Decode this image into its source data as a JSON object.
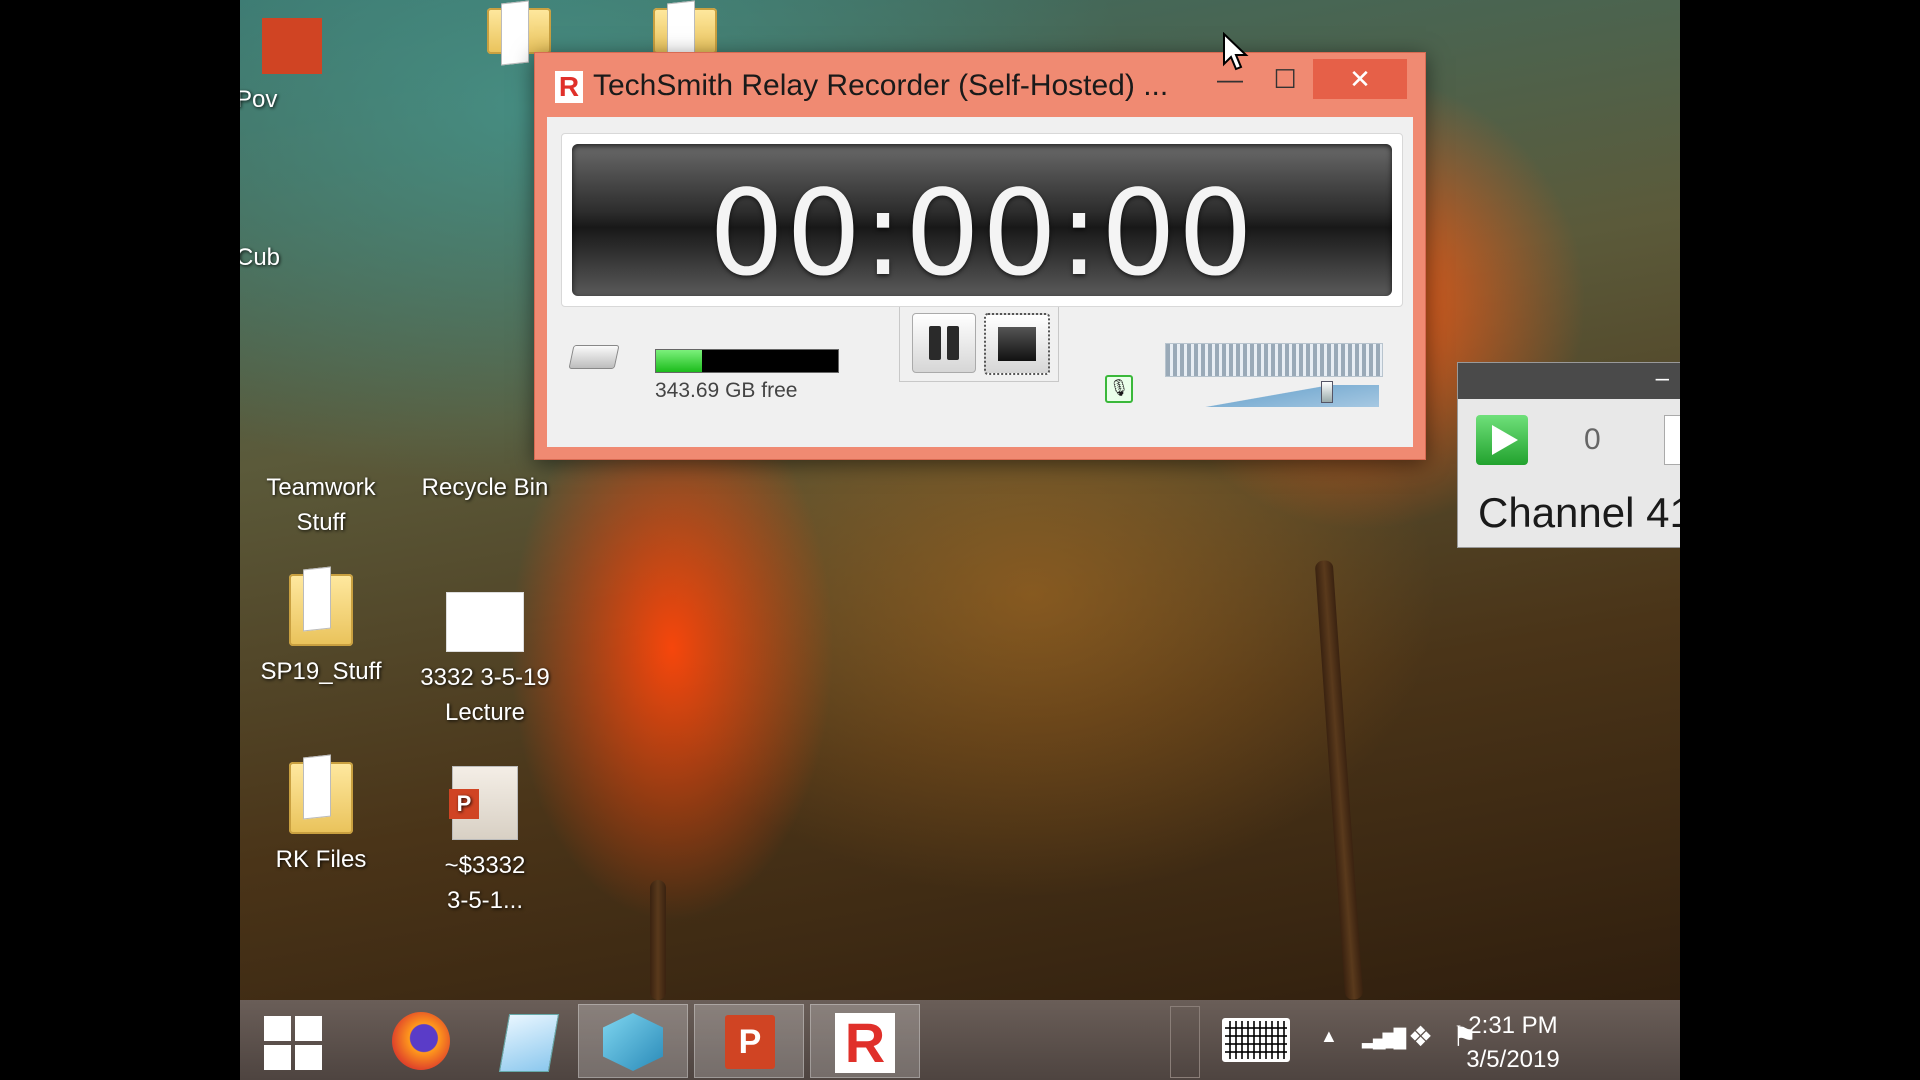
{
  "recorder": {
    "title": "TechSmith Relay Recorder (Self-Hosted) ...",
    "logo_letter": "R",
    "minimize_glyph": "—",
    "maximize_glyph": "☐",
    "close_glyph": "✕",
    "timer": "00:00:00",
    "disk_free": "343.69 GB free",
    "disk_usage_fraction": 0.25,
    "volume_level_fraction": 0.75,
    "accent_color": "#f08a72"
  },
  "desktop": {
    "icons": [
      {
        "label": "Pov",
        "icon": "powerpoint-icon"
      },
      {
        "label": "Cub",
        "icon": "app-icon"
      },
      {
        "label": "Teamwork Stuff",
        "icon": "folder-icon"
      },
      {
        "label": "Recycle Bin",
        "icon": "recycle-bin-icon"
      },
      {
        "label": "SP19_Stuff",
        "icon": "folder-icon"
      },
      {
        "label": "3332 3-5-19 Lecture",
        "icon": "blank-document-icon"
      },
      {
        "label": "RK Files",
        "icon": "folder-icon"
      },
      {
        "label": "~$3332 3-5-1...",
        "icon": "powerpoint-document-icon"
      }
    ]
  },
  "channel_widget": {
    "minimize_glyph": "–",
    "count": "0",
    "name": "Channel 41"
  },
  "taskbar": {
    "apps": [
      "start-icon",
      "firefox-icon",
      "notes-icon",
      "cube-icon",
      "powerpoint-icon",
      "relay-recorder-icon"
    ],
    "tray_arrow": "▲",
    "signal_glyph": "▂▄▆█",
    "dropbox_glyph": "❖",
    "flag_glyph": "⚑",
    "time": "2:31 PM",
    "date": "3/5/2019"
  }
}
